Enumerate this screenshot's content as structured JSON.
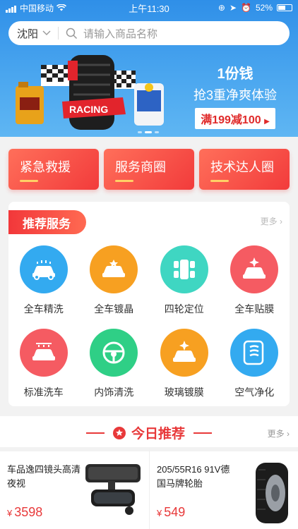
{
  "status": {
    "carrier": "中国移动",
    "time": "上午11:30",
    "battery": "52%"
  },
  "search": {
    "city": "沈阳",
    "placeholder": "请输入商品名称"
  },
  "banner": {
    "line1": "1份钱",
    "line2": "抢3重净爽体验",
    "badge": "满199减100",
    "tire_text": "RACING"
  },
  "quick": [
    {
      "label": "紧急救援"
    },
    {
      "label": "服务商圈"
    },
    {
      "label": "技术达人圈"
    }
  ],
  "services": {
    "title": "推荐服务",
    "more": "更多",
    "items": [
      {
        "label": "全车精洗",
        "icon": "car-wash-icon",
        "color": "#33aaf0"
      },
      {
        "label": "全车镀晶",
        "icon": "car-crystal-icon",
        "color": "#f7a021"
      },
      {
        "label": "四轮定位",
        "icon": "wheel-alignment-icon",
        "color": "#3fd6c2"
      },
      {
        "label": "全车贴膜",
        "icon": "car-film-icon",
        "color": "#f55b62"
      },
      {
        "label": "标准洗车",
        "icon": "standard-wash-icon",
        "color": "#f55b62"
      },
      {
        "label": "内饰清洗",
        "icon": "steering-wheel-icon",
        "color": "#2fcf86"
      },
      {
        "label": "玻璃镀膜",
        "icon": "glass-coating-icon",
        "color": "#f7a021"
      },
      {
        "label": "空气净化",
        "icon": "air-purify-icon",
        "color": "#33aaf0"
      }
    ]
  },
  "today": {
    "title": "今日推荐",
    "more": "更多",
    "products": [
      {
        "name": "车品逸四镜头高清夜视",
        "currency": "¥",
        "price": "3598"
      },
      {
        "name": "205/55R16 91V德国马牌轮胎",
        "currency": "¥",
        "price": "549"
      }
    ]
  }
}
